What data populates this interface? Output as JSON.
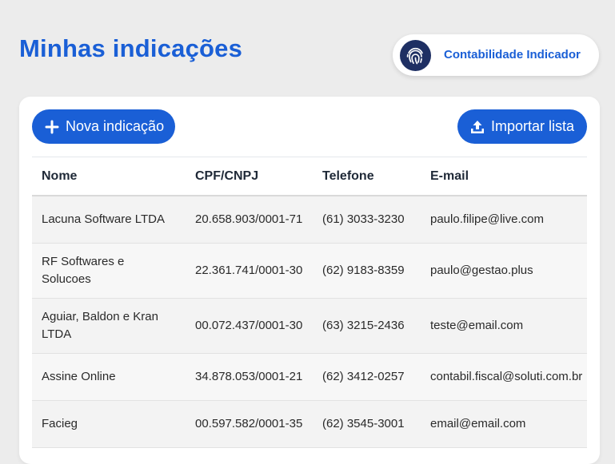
{
  "header": {
    "title": "Minhas indicações",
    "account_name": "Contabilidade Indicador"
  },
  "toolbar": {
    "new_label": "Nova indicação",
    "import_label": "Importar lista"
  },
  "table": {
    "columns": [
      "Nome",
      "CPF/CNPJ",
      "Telefone",
      "E-mail"
    ],
    "rows": [
      [
        "Lacuna Software LTDA",
        "20.658.903/0001-71",
        "(61) 3033-3230",
        "paulo.filipe@live.com"
      ],
      [
        "RF Softwares e Solucoes",
        "22.361.741/0001-30",
        "(62) 9183-8359",
        "paulo@gestao.plus"
      ],
      [
        "Aguiar, Baldon e Kran LTDA",
        "00.072.437/0001-30",
        "(63) 3215-2436",
        "teste@email.com"
      ],
      [
        "Assine Online",
        "34.878.053/0001-21",
        "(62) 3412-0257",
        "contabil.fiscal@soluti.com.br"
      ],
      [
        "Facieg",
        "00.597.582/0001-35",
        "(62) 3545-3001",
        "email@email.com"
      ]
    ]
  },
  "colors": {
    "accent": "#1a5fd6",
    "logo_bg": "#1e2f63",
    "page_bg": "#ececec"
  },
  "icons": {
    "account_logo": "fingerprint-icon",
    "new_button": "plus-icon",
    "import_button": "upload-icon"
  }
}
